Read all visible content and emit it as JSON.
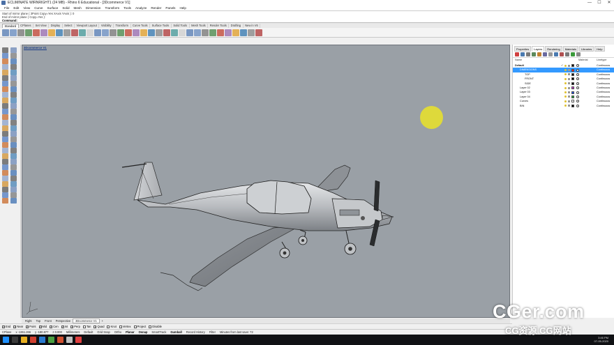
{
  "window": {
    "title": "ECLIMINATE WIRNRIGHT1 (24 MB) - Rhino 6 Educational - [3Dcommerce V1]",
    "controls": [
      "—",
      "☐",
      "✕"
    ]
  },
  "menu": [
    "File",
    "Edit",
    "View",
    "Curve",
    "Surface",
    "Solid",
    "Mesh",
    "Dimension",
    "Transform",
    "Tools",
    "Analyze",
    "Render",
    "Panels",
    "Help"
  ],
  "command_history": {
    "lines": [
      "Start of mirror plane ( 3Point Copy=Yes  XAxis  YAxis ): 0",
      "End of mirror plane ( Copy=Yes ):"
    ],
    "prompt": "Command:"
  },
  "toolbar_tabs": {
    "items": [
      "Standard",
      "CPlanes",
      "Set View",
      "Display",
      "Select",
      "Viewport Layout",
      "Visibility",
      "Transform",
      "Curve Tools",
      "Surface Tools",
      "Solid Tools",
      "Mesh Tools",
      "Render Tools",
      "Drafting",
      "New in V6"
    ],
    "active": 0
  },
  "viewport": {
    "title": "3Dcommerce V1",
    "background": "#9aa0a6"
  },
  "viewport_tabs": {
    "items": [
      "Right",
      "Top",
      "Front",
      "Perspective",
      "3Dcommerce V1",
      "+"
    ],
    "active": 4
  },
  "right_panel": {
    "tabs": [
      "Properties",
      "Layers",
      "Rendering",
      "Materials",
      "Libraries",
      "Help"
    ],
    "active_tab": 1,
    "columns": {
      "name": "Name",
      "material": "Material",
      "linetype": "Linetype"
    },
    "layers": [
      {
        "name": "Default",
        "checked": "✓",
        "color": "#000000",
        "linetype": "Continuous",
        "indent": 0,
        "bold": true
      },
      {
        "name": "DIMENSIONS",
        "checked": "",
        "color": "#ff2020",
        "linetype": "Continuous",
        "indent": 1,
        "selected": true
      },
      {
        "name": "TOP",
        "checked": "",
        "color": "#000000",
        "linetype": "Continuous",
        "indent": 2
      },
      {
        "name": "FRONT",
        "checked": "",
        "color": "#000000",
        "linetype": "Continuous",
        "indent": 2
      },
      {
        "name": "SIDE",
        "checked": "",
        "color": "#000000",
        "linetype": "Continuous",
        "indent": 2
      },
      {
        "name": "Layer 02",
        "checked": "",
        "color": "#c030c0",
        "linetype": "Continuous",
        "indent": 1
      },
      {
        "name": "Layer 03",
        "checked": "",
        "color": "#2050e0",
        "linetype": "Continuous",
        "indent": 1
      },
      {
        "name": "Layer 04",
        "checked": "",
        "color": "#20a030",
        "linetype": "Continuous",
        "indent": 1
      },
      {
        "name": "Curves",
        "checked": "",
        "color": "#ffffff",
        "linetype": "Continuous",
        "indent": 1
      },
      {
        "name": "BIN",
        "checked": "",
        "color": "#000000",
        "linetype": "Continuous",
        "indent": 1
      }
    ]
  },
  "osnaps": [
    {
      "label": "End",
      "on": true
    },
    {
      "label": "Near",
      "on": true
    },
    {
      "label": "Point",
      "on": true
    },
    {
      "label": "Mid",
      "on": true
    },
    {
      "label": "Cen",
      "on": true
    },
    {
      "label": "Int",
      "on": true
    },
    {
      "label": "Perp",
      "on": true
    },
    {
      "label": "Tan",
      "on": false
    },
    {
      "label": "Quad",
      "on": true
    },
    {
      "label": "Knot",
      "on": false
    },
    {
      "label": "Vertex",
      "on": false
    },
    {
      "label": "Project",
      "on": false
    },
    {
      "label": "Disable",
      "on": false
    }
  ],
  "status_bar": {
    "cplane": "CPlane",
    "x": "x -1361.266",
    "y": "y -180.877",
    "z": "z 0.000",
    "units": "Millimeters",
    "layer": "Default",
    "toggles": [
      "Grid Snap",
      "Ortho",
      "Planar",
      "Osnap",
      "SmartTrack",
      "Gumball",
      "Record History",
      "Filter"
    ],
    "bold_toggles": [
      "Planar",
      "Osnap",
      "Gumball"
    ],
    "message": "Minutes from last save: 72"
  },
  "taskbar": {
    "time": "3:46 PM",
    "date": "07-05-2020"
  },
  "watermark": {
    "line1": "CGer.com",
    "line2": "CG资源 CG网站"
  },
  "colors": {
    "accent": "#3399ff",
    "cursor_highlight": "#eae328",
    "viewport_title": "#1b3e86"
  }
}
